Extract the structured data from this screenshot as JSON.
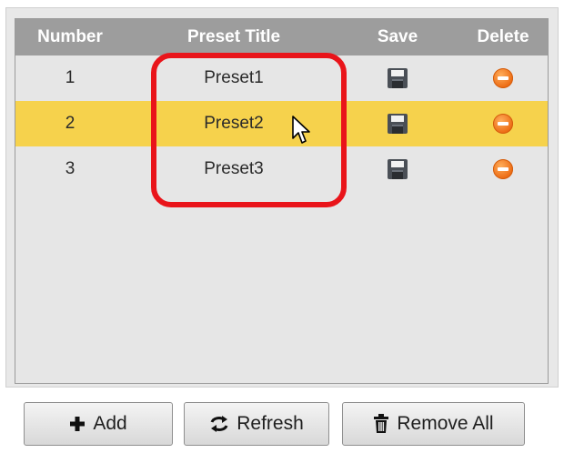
{
  "table": {
    "headers": {
      "number": "Number",
      "title": "Preset Title",
      "save": "Save",
      "delete": "Delete"
    },
    "rows": [
      {
        "number": "1",
        "title": "Preset1",
        "selected": false
      },
      {
        "number": "2",
        "title": "Preset2",
        "selected": true
      },
      {
        "number": "3",
        "title": "Preset3",
        "selected": false
      }
    ]
  },
  "buttons": {
    "add_label": "Add",
    "refresh_label": "Refresh",
    "remove_all_label": "Remove All"
  },
  "icons": {
    "save": "floppy-disk-icon",
    "delete": "minus-circle-icon",
    "add": "plus-icon",
    "refresh": "refresh-icon",
    "remove_all": "trash-icon"
  },
  "colors": {
    "header_bg": "#9d9d9d",
    "selected_row": "#f6d24c",
    "highlight_outline": "#e9141a",
    "delete_icon": "#ec6a12"
  }
}
